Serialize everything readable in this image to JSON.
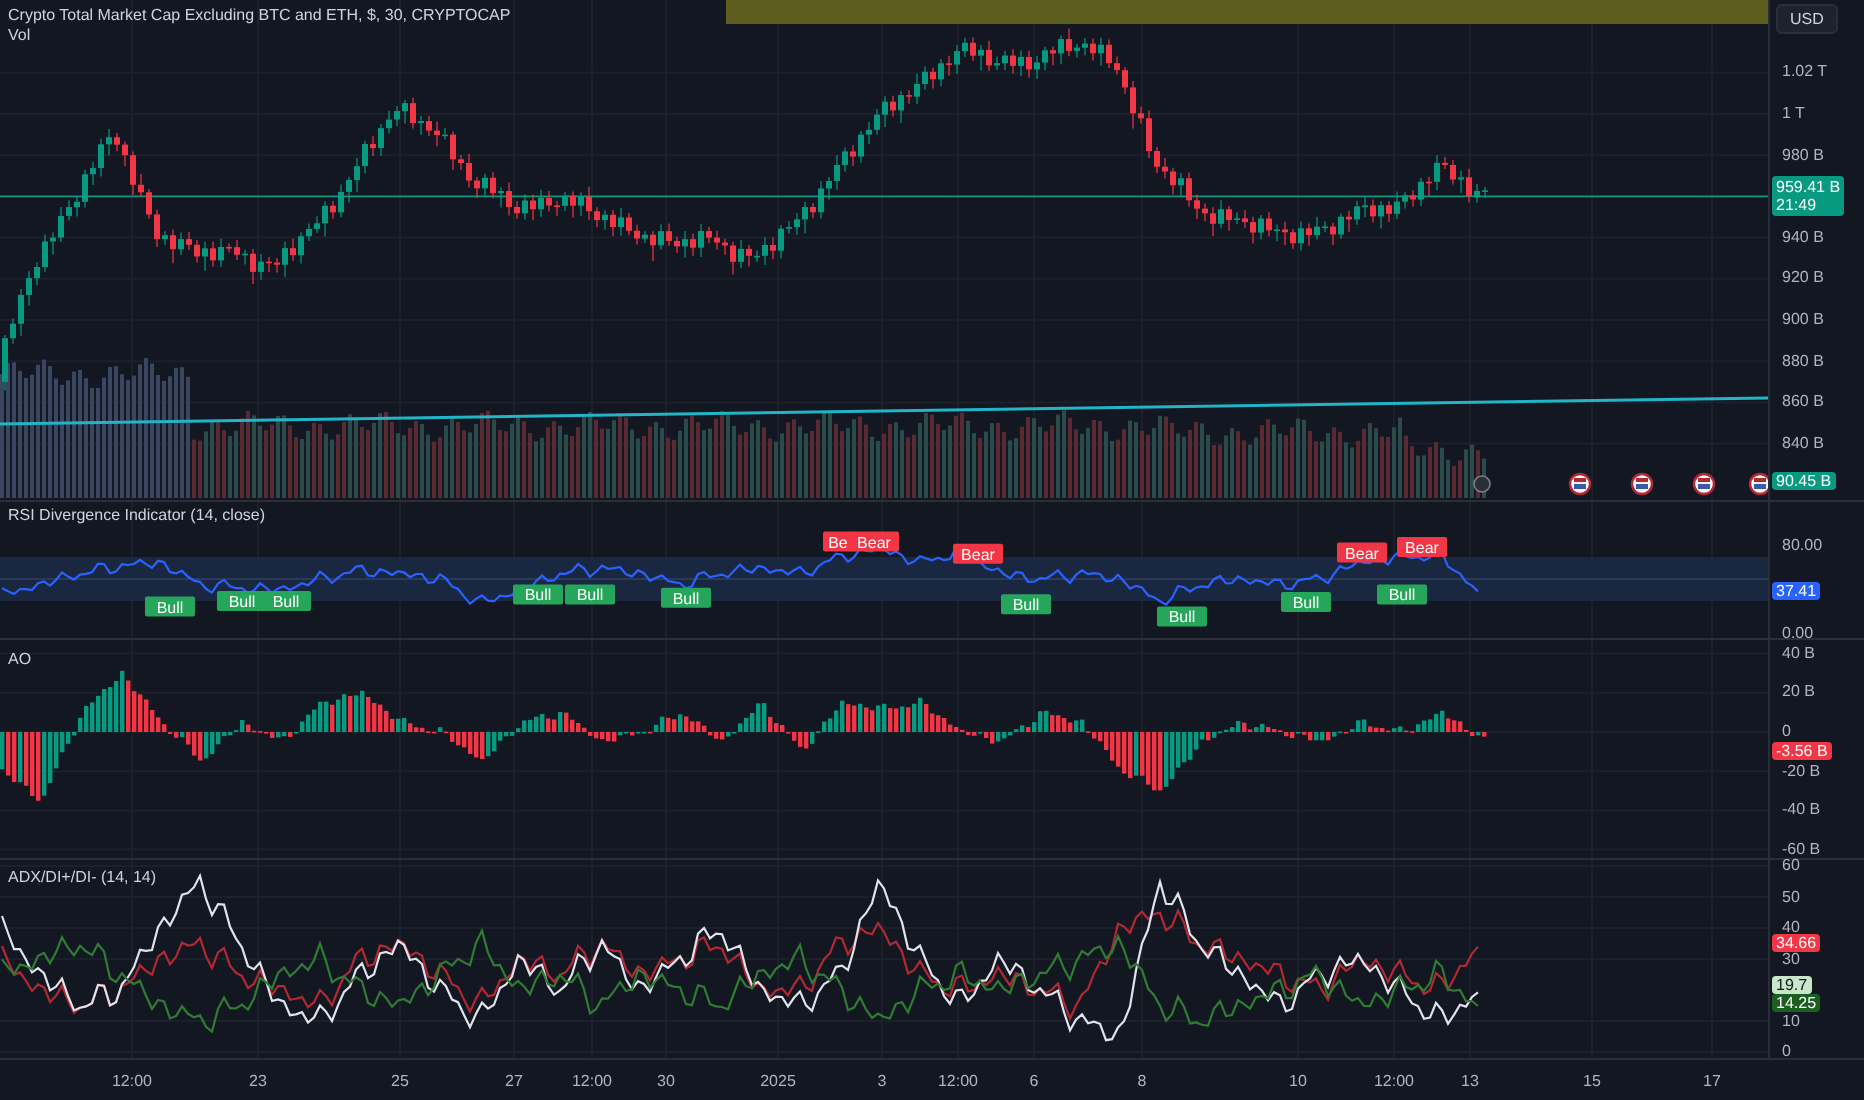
{
  "header": {
    "title": "Crypto Total Market Cap Excluding BTC and ETH, $, 30, CRYPTOCAP",
    "volume_title": "Vol"
  },
  "currency_button": "USD",
  "main": {
    "price_label": "959.41 B",
    "countdown": "21:49",
    "volume_value": "90.45 B",
    "axis_labels": [
      "1.02 T",
      "1 T",
      "980 B",
      "940 B",
      "920 B",
      "900 B",
      "880 B",
      "860 B",
      "840 B"
    ]
  },
  "rsi": {
    "title": "RSI Divergence Indicator (14, close)",
    "value_label": "37.41",
    "axis_labels": [
      "80.00",
      "0.00"
    ],
    "signals": [
      {
        "text": "Bull",
        "kind": "bull"
      },
      {
        "text": "Bull",
        "kind": "bull"
      },
      {
        "text": "Bull",
        "kind": "bull"
      },
      {
        "text": "Bull",
        "kind": "bull"
      },
      {
        "text": "Bull",
        "kind": "bull"
      },
      {
        "text": "Bull",
        "kind": "bull"
      },
      {
        "text": "Bull",
        "kind": "bull"
      },
      {
        "text": "Bull",
        "kind": "bull"
      },
      {
        "text": "Bull",
        "kind": "bull"
      },
      {
        "text": "Bull",
        "kind": "bull"
      },
      {
        "text": "Be",
        "kind": "bear"
      },
      {
        "text": "Bear",
        "kind": "bear"
      },
      {
        "text": "Bear",
        "kind": "bear"
      },
      {
        "text": "Bear",
        "kind": "bear"
      },
      {
        "text": "Bear",
        "kind": "bear"
      }
    ]
  },
  "ao": {
    "title": "AO",
    "value_label": "-3.56 B",
    "axis_labels": [
      "40 B",
      "20 B",
      "0",
      "-20 B",
      "-40 B",
      "-60 B"
    ]
  },
  "adx": {
    "title": "ADX/DI+/DI- (14, 14)",
    "value_labels": [
      {
        "text": "34.66",
        "color": "#f23645"
      },
      {
        "text": "19.7",
        "color": "#c8e6c9"
      },
      {
        "text": "14.25",
        "color": "#1b5e20"
      }
    ],
    "axis_labels": [
      "60",
      "50",
      "40",
      "30",
      "10",
      "0"
    ]
  },
  "time_axis": [
    "12:00",
    "23",
    "25",
    "27",
    "12:00",
    "30",
    "2025",
    "3",
    "12:00",
    "6",
    "8",
    "10",
    "12:00",
    "13",
    "15",
    "17"
  ]
}
